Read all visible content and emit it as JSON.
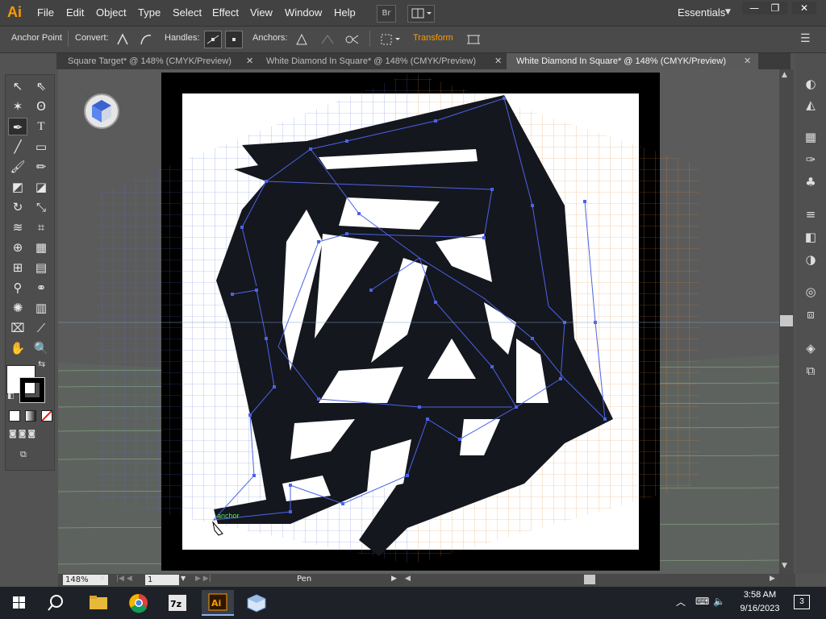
{
  "app": {
    "logo": "Ai",
    "workspace": "Essentials",
    "bridge_label": "Br"
  },
  "menu": [
    "File",
    "Edit",
    "Object",
    "Type",
    "Select",
    "Effect",
    "View",
    "Window",
    "Help"
  ],
  "window_controls": [
    "—",
    "❐",
    "✕"
  ],
  "control_bar": {
    "tool_name": "Anchor Point",
    "convert_label": "Convert:",
    "handles_label": "Handles:",
    "anchors_label": "Anchors:",
    "transform_label": "Transform"
  },
  "tabs": [
    {
      "label": "Square Target* @ 148% (CMYK/Preview)",
      "active": false
    },
    {
      "label": "White Diamond In Square* @ 148% (CMYK/Preview)",
      "active": false
    },
    {
      "label": "White Diamond In Square* @ 148% (CMYK/Preview)",
      "active": true
    }
  ],
  "tab_close": "✕",
  "canvas": {
    "tooltip": "anchor"
  },
  "status": {
    "zoom": "148%",
    "artboard": "1",
    "tool": "Pen"
  },
  "taskbar": {
    "time": "3:58 AM",
    "date": "9/16/2023",
    "notifications": "3"
  },
  "colors": {
    "accent": "#ff9a00",
    "grid_left": "#5a6fd6",
    "grid_right": "#e08a3a",
    "grid_floor": "#7fb37f"
  }
}
